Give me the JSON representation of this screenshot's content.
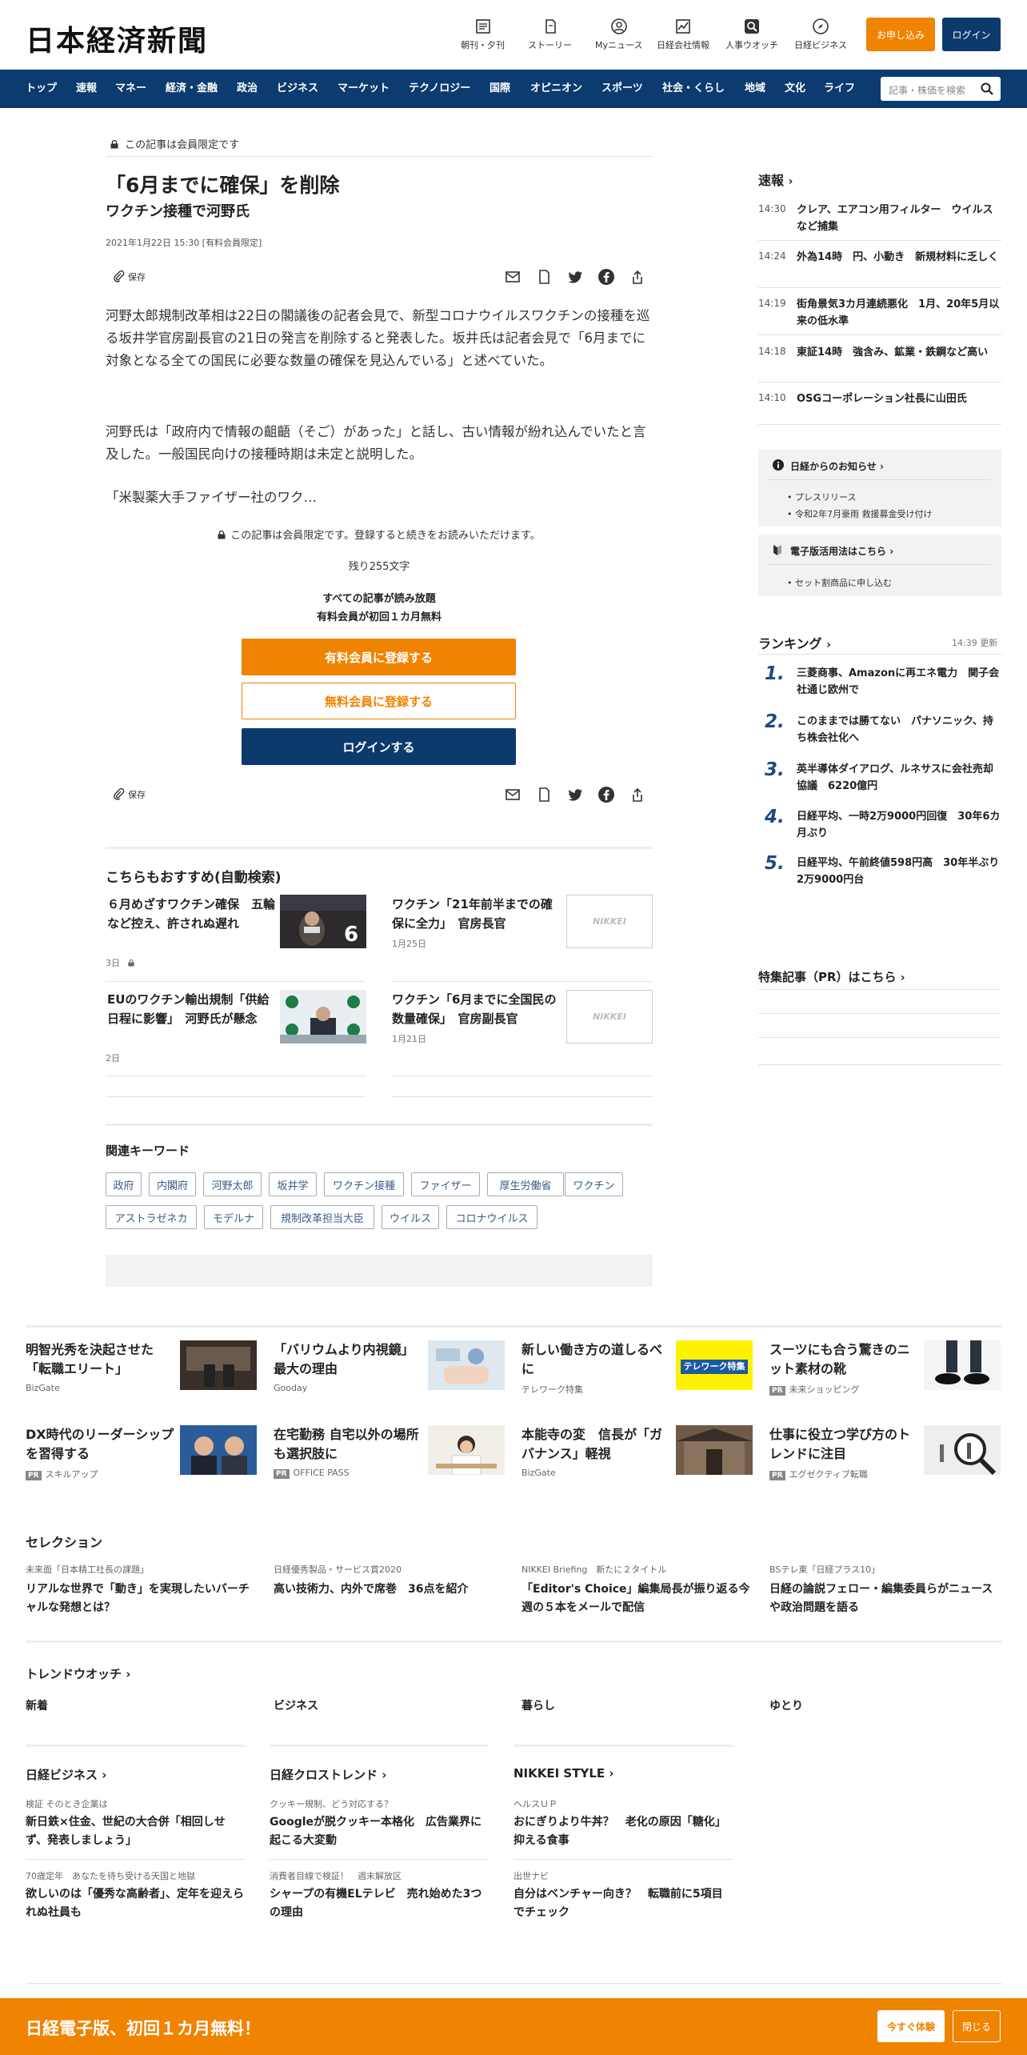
{
  "header": {
    "logo": "日本経済新聞",
    "icons": [
      {
        "label": "朝刊・夕刊",
        "icon": "newspaper-icon"
      },
      {
        "label": "ストーリー",
        "icon": "story-icon"
      },
      {
        "label": "Myニュース",
        "icon": "user-icon"
      },
      {
        "label": "日経会社情報",
        "icon": "chart-icon"
      },
      {
        "label": "人事ウオッチ",
        "icon": "search-person-icon"
      },
      {
        "label": "日経ビジネス",
        "icon": "compass-icon"
      }
    ],
    "apply_label": "お申し込み",
    "login_label": "ログイン"
  },
  "nav": {
    "items": [
      "トップ",
      "速報",
      "マネー",
      "経済・金融",
      "政治",
      "ビジネス",
      "マーケット",
      "テクノロジー",
      "国際",
      "オピニオン",
      "スポーツ",
      "社会・くらし",
      "地域",
      "文化",
      "ライフ"
    ],
    "search_placeholder": "記事・株価を検索"
  },
  "article": {
    "member_badge": "この記事は会員限定です",
    "title": "「6月までに確保」を削除",
    "subtitle": "ワクチン接種で河野氏",
    "date": "2021年1月22日 15:30 [有料会員限定]",
    "save_label": "保存",
    "paragraphs": [
      "河野太郎規制改革相は22日の閣議後の記者会見で、新型コロナウイルスワクチンの接種を巡る坂井学官房副長官の21日の発言を削除すると発表した。坂井氏は記者会見で「6月までに対象となる全ての国民に必要な数量の確保を見込んでいる」と述べていた。",
      "河野氏は「政府内で情報の齟齬（そご）があった」と話し、古い情報が紛れ込んでいたと言及した。一般国民向けの接種時期は未定と説明した。",
      "「米製薬大手ファイザー社のワク…"
    ],
    "paywall_note": "この記事は会員限定です。登録すると続きをお読みいただけます。",
    "remaining": "残り255文字",
    "offer_line1": "すべての記事が読み放題",
    "offer_line2": "有料会員が初回１カ月無料",
    "btn_paid": "有料会員に登録する",
    "btn_free": "無料会員に登録する",
    "btn_login": "ログインする"
  },
  "recommend": {
    "heading": "こちらもおすすめ(自動検索)",
    "items": [
      {
        "title": "６月めざすワクチン確保　五輪など控え、許されぬ遅れ",
        "date": "3日"
      },
      {
        "title": "ワクチン「21年前半までの確保に全力」　官房長官",
        "date": "1月25日"
      },
      {
        "title": "EUのワクチン輸出規制「供給日程に影響」　河野氏が懸念",
        "date": "2日"
      },
      {
        "title": "ワクチン「6月までに全国民の数量確保」　官房副長官",
        "date": "1月21日"
      }
    ],
    "placeholder_logo": "NIKKEI"
  },
  "keywords": {
    "heading": "関連キーワード",
    "items": [
      "政府",
      "内閣府",
      "河野太郎",
      "坂井学",
      "ワクチン接種",
      "ファイザー",
      "厚生労働省",
      "ワクチン",
      "アストラゼネカ",
      "モデルナ",
      "規制改革担当大臣",
      "ウイルス",
      "コロナウイルス"
    ]
  },
  "sidebar": {
    "sokuho_heading": "速報",
    "sokuho": [
      {
        "time": "14:30",
        "text": "クレア、エアコン用フィルター　ウイルスなど捕集"
      },
      {
        "time": "14:24",
        "text": "外為14時　円、小動き　新規材料に乏しく"
      },
      {
        "time": "14:19",
        "text": "街角景気3カ月連続悪化　1月、20年5月以来の低水準"
      },
      {
        "time": "14:18",
        "text": "東証14時　強含み、鉱業・鉄鋼など高い"
      },
      {
        "time": "14:10",
        "text": "OSGコーポレーション社長に山田氏"
      }
    ],
    "notice_heading": "日経からのお知らせ",
    "notices": [
      "プレスリリース",
      "令和2年7月豪雨 救援募金受け付け"
    ],
    "guide_heading": "電子版活用法はこちら",
    "guide_items": [
      "セット割商品に申し込む"
    ],
    "ranking_heading": "ランキング",
    "ranking_updated": "14:39  更新",
    "ranking": [
      {
        "no": "1.",
        "text": "三菱商事、Amazonに再エネ電力　関子会社通じ欧州で"
      },
      {
        "no": "2.",
        "text": "このままでは勝てない　パナソニック、持ち株会社化へ"
      },
      {
        "no": "3.",
        "text": "英半導体ダイアログ、ルネサスに会社売却協議　6220億円"
      },
      {
        "no": "4.",
        "text": "日経平均、一時2万9000円回復　30年6カ月ぶり"
      },
      {
        "no": "5.",
        "text": "日経平均、午前終値598円高　30年半ぶり2万9000円台"
      }
    ],
    "pr_heading": "特集記事（PR）はこちら"
  },
  "pr_grid": [
    {
      "title": "明智光秀を決起させた「転職エリート」",
      "source": "BizGate",
      "pr": false
    },
    {
      "title": "「バリウムより内視鏡」　最大の理由",
      "source": "Gooday",
      "pr": false
    },
    {
      "title": "新しい働き方の道しるべに",
      "source": "テレワーク特集",
      "pr": false
    },
    {
      "title": "スーツにも合う驚きのニット素材の靴",
      "source": "未来ショッピング",
      "pr": true
    },
    {
      "title": "DX時代のリーダーシップを習得する",
      "source": "スキルアップ",
      "pr": true
    },
    {
      "title": "在宅勤務 自宅以外の場所も選択肢に",
      "source": "OFFICE PASS",
      "pr": true
    },
    {
      "title": "本能寺の変　信長が「ガバナンス」軽視",
      "source": "BizGate",
      "pr": false
    },
    {
      "title": "仕事に役立つ学び方のトレンドに注目",
      "source": "エグゼクティブ転職",
      "pr": true
    }
  ],
  "pr_tag": "PR",
  "telework_banner": "テレワーク特集",
  "selection": {
    "heading": "セレクション",
    "items": [
      {
        "kicker": "未来面「日本精工社長の課題」",
        "title": "リアルな世界で「動き」を実現したいバーチャルな発想とは？"
      },
      {
        "kicker": "日経優秀製品・サービス賞2020",
        "title": "高い技術力、内外で席巻　36点を紹介"
      },
      {
        "kicker": "NIKKEI Briefing　新たに２タイトル",
        "title": "「Editor's Choice」編集局長が振り返る今週の５本をメールで配信"
      },
      {
        "kicker": "BSテレ東「日経プラス10」",
        "title": "日経の論説フェロー・編集委員らがニュースや政治問題を語る"
      }
    ]
  },
  "trend": {
    "heading": "トレンドウオッチ",
    "cols": [
      "新着",
      "ビジネス",
      "暮らし",
      "ゆとり"
    ]
  },
  "media": [
    {
      "heading": "日経ビジネス",
      "items": [
        {
          "kicker": "検証 そのとき企業は",
          "title": "新日鉄×住金、世紀の大合併「相回しせず、発表しましょう」"
        },
        {
          "kicker": "70歳定年　あなたを待ち受ける天国と地獄",
          "title": "欲しいのは「優秀な高齢者」、定年を迎えられぬ社員も"
        }
      ]
    },
    {
      "heading": "日経クロストレンド",
      "items": [
        {
          "kicker": "クッキー規制、どう対応する？",
          "title": "Googleが脱クッキー本格化　広告業界に起こる大変動"
        },
        {
          "kicker": "消費者目線で検証！　週末解放区",
          "title": "シャープの有機ELテレビ　売れ始めた3つの理由"
        }
      ]
    },
    {
      "heading": "NIKKEI STYLE",
      "items": [
        {
          "kicker": "ヘルスＵＰ",
          "title": "おにぎりより牛丼？　老化の原因「糖化」抑える食事"
        },
        {
          "kicker": "出世ナビ",
          "title": "自分はベンチャー向き？　転職前に5項目でチェック"
        }
      ]
    }
  ],
  "promo": {
    "text": "日経電子版、初回１カ月無料！",
    "try_label": "今すぐ体験",
    "close_label": "閉じる"
  },
  "colors": {
    "brand_navy": "#0b3b6f",
    "accent_orange": "#f08300",
    "rank_blue": "#1a4a84"
  }
}
